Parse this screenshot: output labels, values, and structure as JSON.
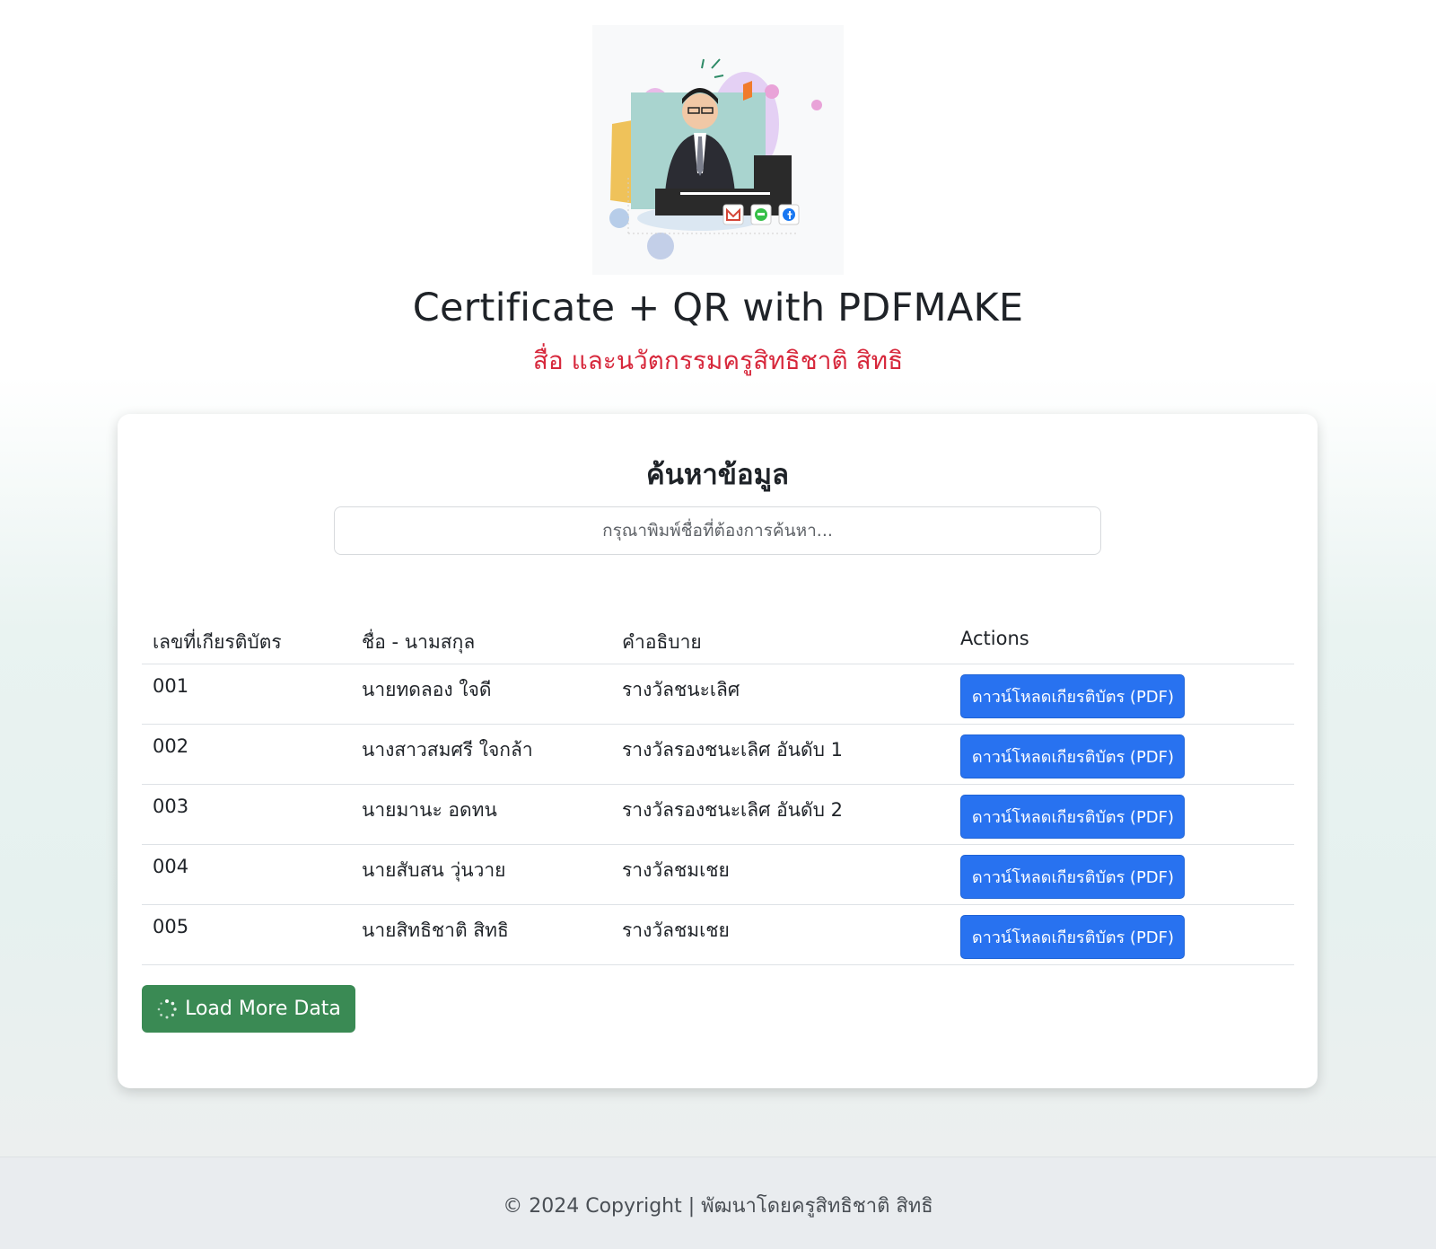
{
  "header": {
    "title": "Certificate + QR with PDFMAKE",
    "subtitle": "สื่อ และนวัตกรรมครูสิทธิชาติ สิทธิ"
  },
  "search": {
    "heading": "ค้นหาข้อมูล",
    "placeholder": "กรุณาพิมพ์ชื่อที่ต้องการค้นหา..."
  },
  "table": {
    "headers": [
      "เลขที่เกียรติบัตร",
      "ชื่อ - นามสกุล",
      "คำอธิบาย",
      "Actions"
    ],
    "rows": [
      {
        "id": "001",
        "name": "นายทดลอง ใจดี",
        "description": "รางวัลชนะเลิศ",
        "action": "ดาวน์โหลดเกียรติบัตร (PDF)"
      },
      {
        "id": "002",
        "name": "นางสาวสมศรี ใจกล้า",
        "description": "รางวัลรองชนะเลิศ อันดับ 1",
        "action": "ดาวน์โหลดเกียรติบัตร (PDF)"
      },
      {
        "id": "003",
        "name": "นายมานะ อดทน",
        "description": "รางวัลรองชนะเลิศ อันดับ 2",
        "action": "ดาวน์โหลดเกียรติบัตร (PDF)"
      },
      {
        "id": "004",
        "name": "นายสับสน วุ่นวาย",
        "description": "รางวัลชมเชย",
        "action": "ดาวน์โหลดเกียรติบัตร (PDF)"
      },
      {
        "id": "005",
        "name": "นายสิทธิชาติ สิทธิ",
        "description": "รางวัลชมเชย",
        "action": "ดาวน์โหลดเกียรติบัตร (PDF)"
      }
    ]
  },
  "load_more": {
    "label": "Load More Data",
    "icon": "spinner-icon"
  },
  "footer": {
    "text": "© 2024 Copyright | พัฒนาโดยครูสิทธิชาติ สิทธิ"
  },
  "colors": {
    "subtitle": "#d7283c",
    "primary_button": "#2872f0",
    "success_button": "#3a8a54",
    "footer_bg": "#e9ecef"
  },
  "icons": {
    "social": [
      "gmail-icon",
      "line-icon",
      "facebook-icon"
    ]
  }
}
